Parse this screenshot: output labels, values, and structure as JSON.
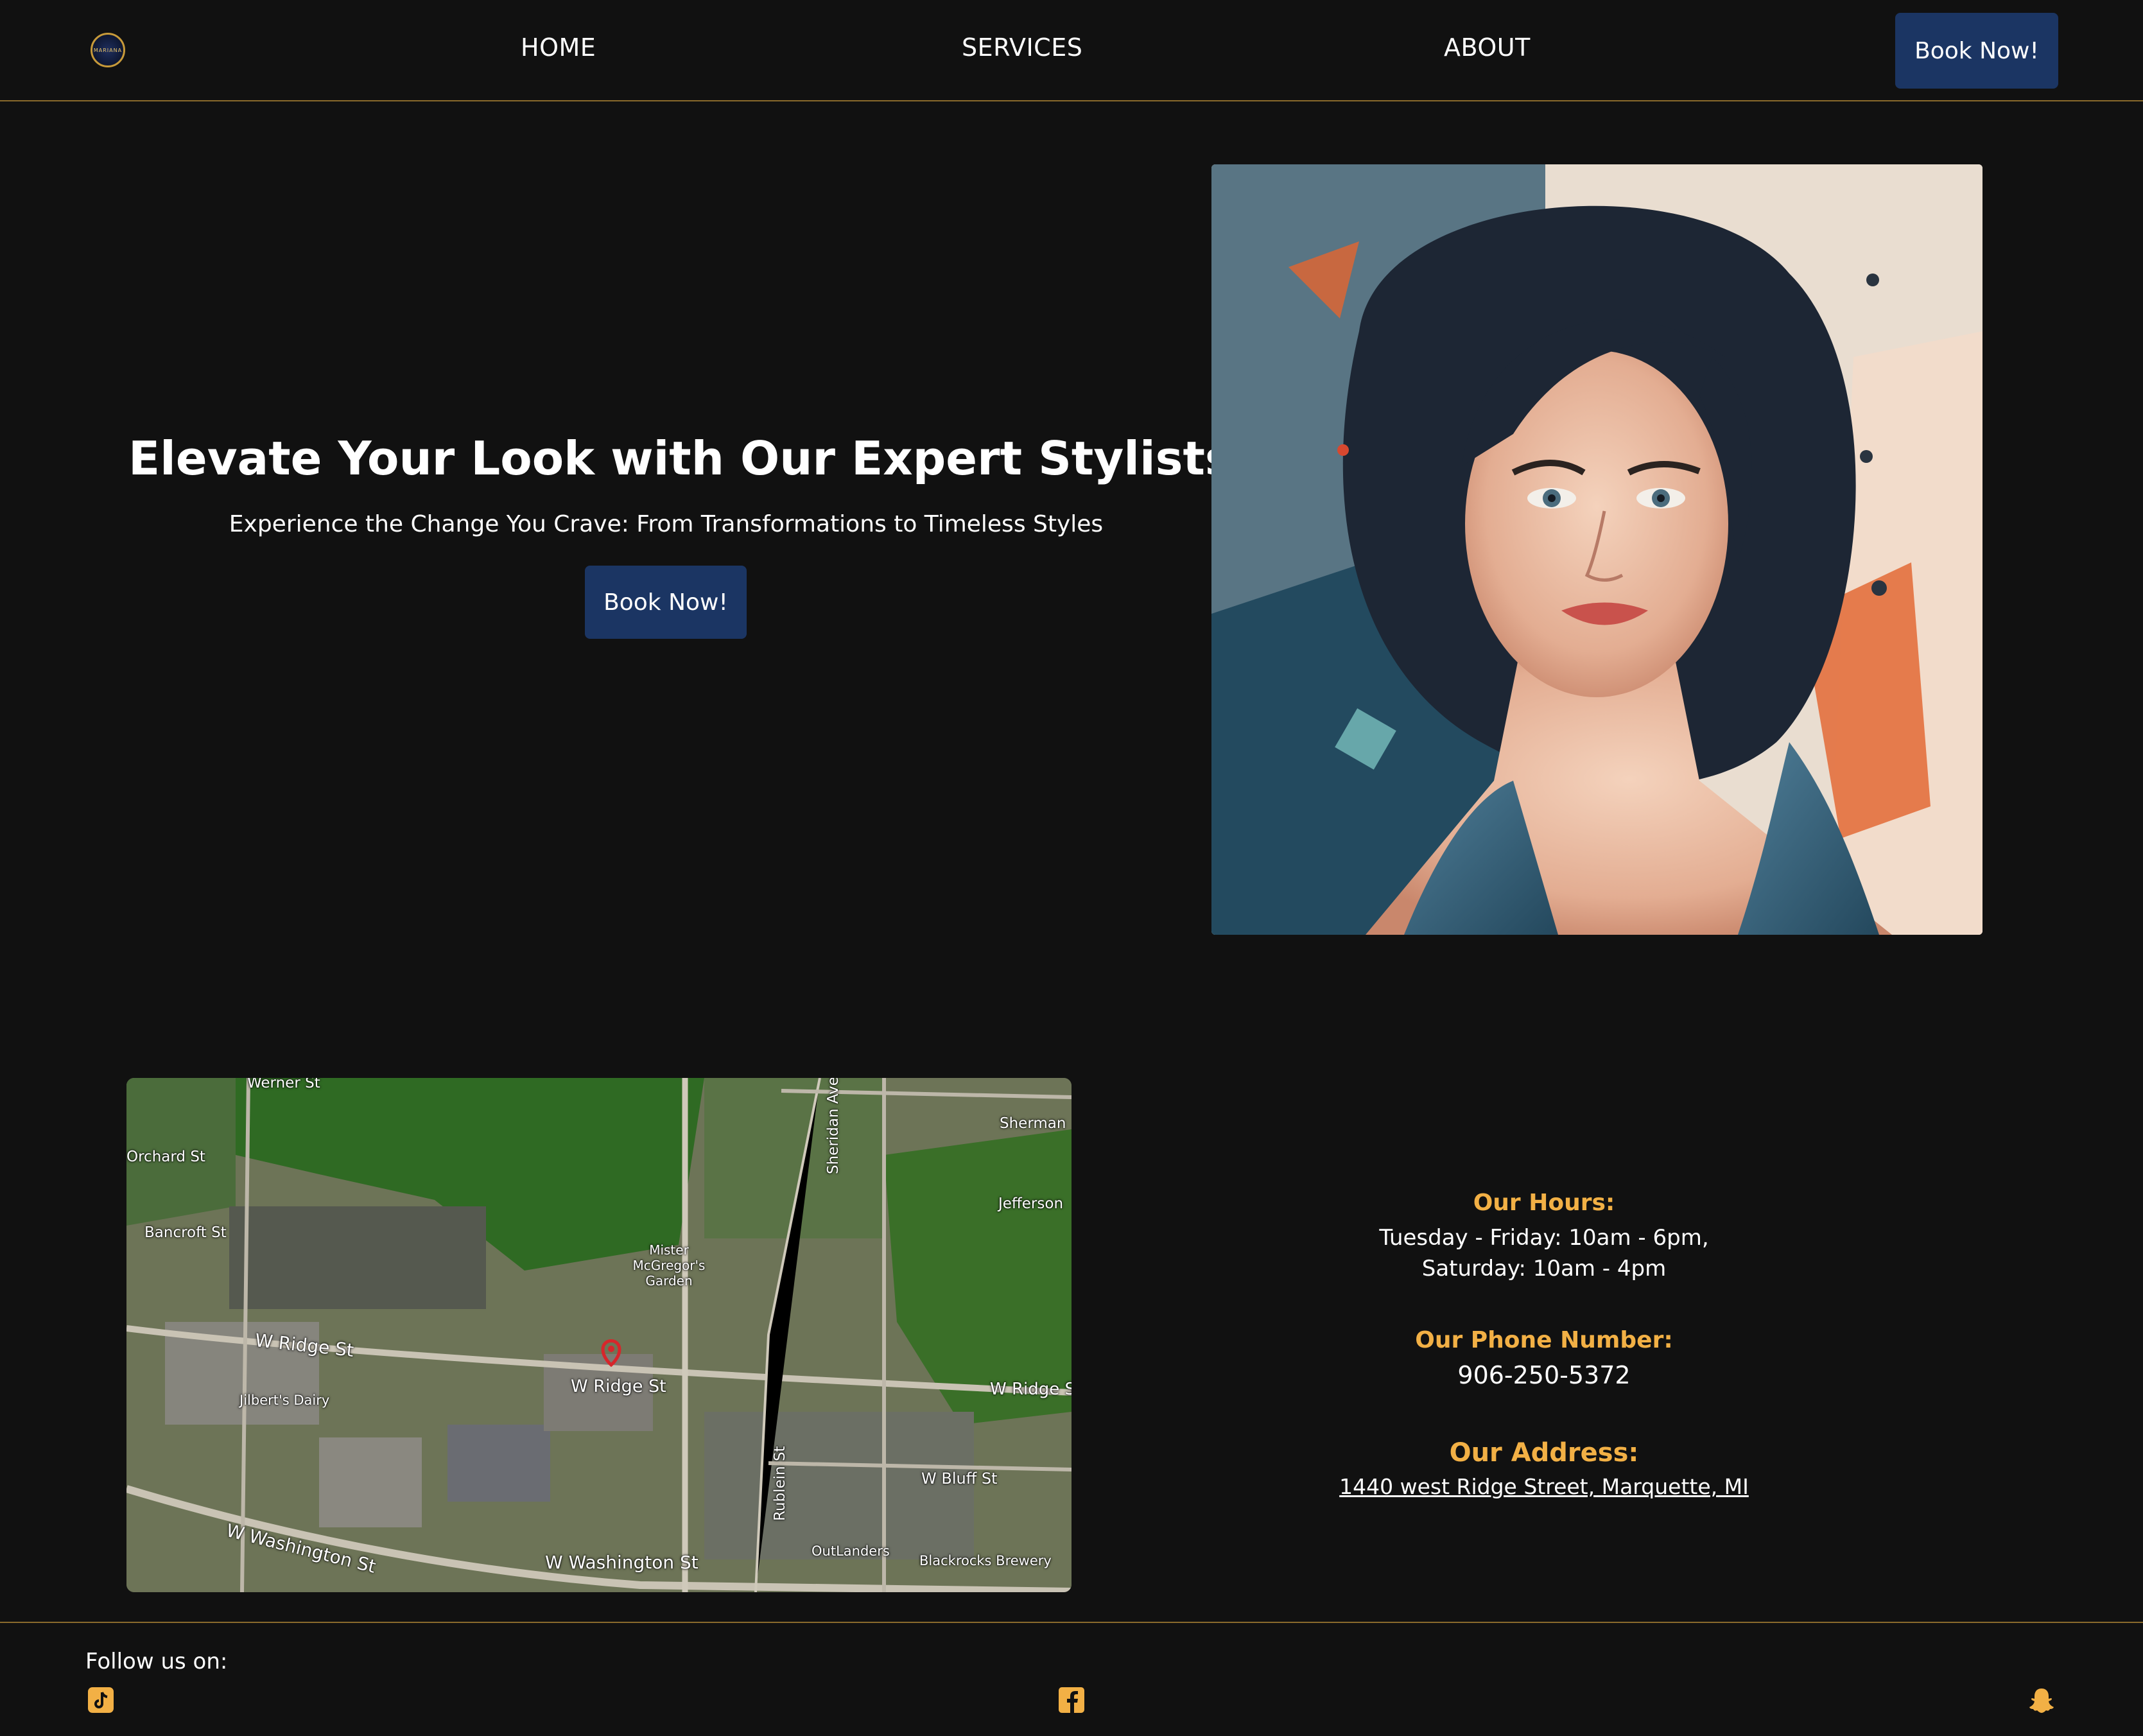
{
  "nav": {
    "logo_text": "MARIANA",
    "links": [
      "HOME",
      "SERVICES",
      "ABOUT"
    ],
    "book_label": "Book Now!"
  },
  "hero": {
    "title": "Elevate Your Look with Our Expert Stylists",
    "subtitle": "Experience the Change You Crave: From Transformations to Timeless Styles",
    "book_label": "Book Now!"
  },
  "map": {
    "labels": {
      "werner": "Werner St",
      "orchard": "Orchard St",
      "bancroft": "Bancroft St",
      "sherman": "Sherman",
      "jefferson": "Jefferson",
      "sheridan": "Sheridan Ave",
      "garden": "Mister McGregor's Garden",
      "ridge_west": "W Ridge St",
      "ridge_mid": "W Ridge St",
      "ridge_east": "W Ridge S",
      "jilberts": "Jilbert's Dairy",
      "rublein": "Rublein St",
      "bluff": "W Bluff St",
      "washington_west": "W Washington St",
      "washington_mid": "W Washington St",
      "outlanders": "OutLanders",
      "blackrocks": "Blackrocks Brewery"
    },
    "pin_color": "#d7262b"
  },
  "info": {
    "hours_heading": "Our Hours:",
    "hours_line1": "Tuesday - Friday: 10am - 6pm,",
    "hours_line2": "Saturday: 10am - 4pm",
    "phone_heading": "Our Phone Number:",
    "phone": "906-250-5372",
    "address_heading": "Our Address:",
    "address": "1440 west Ridge Street, Marquette, MI"
  },
  "footer": {
    "follow_label": "Follow us on:",
    "icons": [
      "tiktok-icon",
      "facebook-icon",
      "snapchat-icon"
    ]
  },
  "colors": {
    "background": "#111111",
    "accent": "#f2b045",
    "button": "#1b3563",
    "divider": "#8a6a2c"
  }
}
